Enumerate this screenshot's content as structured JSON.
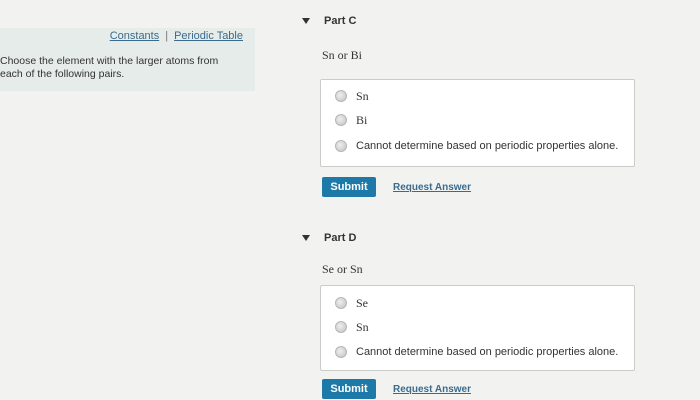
{
  "left": {
    "links": [
      "Constants",
      "Periodic Table"
    ],
    "separator": "|",
    "instructions": "Choose the element with the larger atoms from\neach of the following pairs."
  },
  "parts": [
    {
      "title": "Part C",
      "question": "Sn or Bi",
      "options": [
        "Sn",
        "Bi",
        "Cannot determine based on periodic properties alone."
      ],
      "submit": "Submit",
      "request": "Request Answer"
    },
    {
      "title": "Part D",
      "question": "Se or Sn",
      "options": [
        "Se",
        "Sn",
        "Cannot determine based on periodic properties alone."
      ],
      "submit": "Submit",
      "request": "Request Answer"
    }
  ]
}
